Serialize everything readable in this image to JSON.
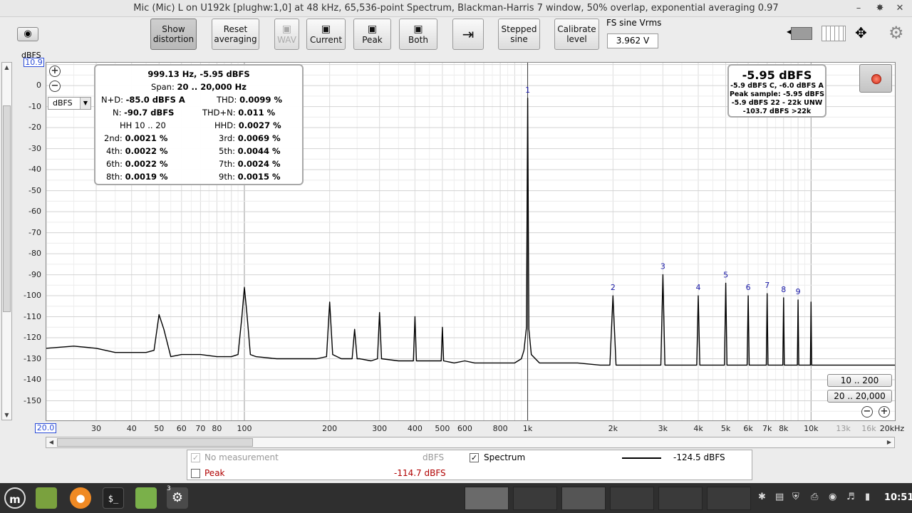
{
  "window": {
    "title": "Mic (Mic) L on U192k [plughw:1,0] at 48 kHz, 65,536-point Spectrum, Blackman-Harris 7 window, 50% overlap, exponential averaging 0.97",
    "minimize": "–",
    "restore": "✸",
    "close": "✕"
  },
  "toolbar": {
    "show_distortion_1": "Show",
    "show_distortion_2": "distortion",
    "reset_1": "Reset",
    "reset_2": "averaging",
    "wav": "WAV",
    "current": "Current",
    "peak": "Peak",
    "both": "Both",
    "stepped_1": "Stepped",
    "stepped_2": "sine",
    "calibrate_1": "Calibrate",
    "calibrate_2": "level",
    "fs_label": "FS sine Vrms",
    "fs_value": "3.962 V"
  },
  "axes": {
    "y_unit": "dBFS",
    "y_top": "10.9",
    "y_ticks": [
      "0",
      "-10",
      "-20",
      "-30",
      "-40",
      "-50",
      "-60",
      "-70",
      "-80",
      "-90",
      "-100",
      "-110",
      "-120",
      "-130",
      "-140",
      "-150"
    ],
    "x_start": "20.0",
    "x_ticks": [
      "30",
      "40",
      "50",
      "60",
      "70",
      "80",
      "100",
      "200",
      "300",
      "400",
      "500",
      "600",
      "800",
      "1k",
      "2k",
      "3k",
      "4k",
      "5k",
      "6k",
      "7k",
      "8k",
      "10k",
      "13k",
      "16k",
      "20kHz"
    ],
    "unit_select": "dBFS"
  },
  "info": {
    "line1": "999.13 Hz, -5.95 dBFS",
    "span_label": "Span:",
    "span_value": "20 .. 20,000 Hz",
    "nd_label": "N+D:",
    "nd_value": "-85.0 dBFS A",
    "thd_label": "THD:",
    "thd_value": "0.0099 %",
    "n_label": "N:",
    "n_value": "-90.7 dBFS",
    "thdn_label": "THD+N:",
    "thdn_value": "0.011 %",
    "hh_label": "HH 10 .. 20",
    "hhd_label": "HHD:",
    "hhd_value": "0.0027 %",
    "h2_label": "2nd:",
    "h2_value": "0.0021 %",
    "h3_label": "3rd:",
    "h3_value": "0.0069 %",
    "h4_label": "4th:",
    "h4_value": "0.0022 %",
    "h5_label": "5th:",
    "h5_value": "0.0044 %",
    "h6_label": "6th:",
    "h6_value": "0.0022 %",
    "h7_label": "7th:",
    "h7_value": "0.0024 %",
    "h8_label": "8th:",
    "h8_value": "0.0019 %",
    "h9_label": "9th:",
    "h9_value": "0.0015 %"
  },
  "level": {
    "main": "-5.95 dBFS",
    "l1": "-5.9 dBFS C, -6.0 dBFS A",
    "l2": "Peak sample: -5.95 dBFS",
    "l3": "-5.9 dBFS 22 - 22k UNW",
    "l4": "-103.7 dBFS >22k"
  },
  "ranges": {
    "r1": "10 .. 200",
    "r2": "20 .. 20,000"
  },
  "legend": {
    "no_measurement": "No measurement",
    "no_measurement_unit": "dBFS",
    "spectrum": "Spectrum",
    "spectrum_value": "-124.5 dBFS",
    "peak": "Peak",
    "peak_value": "-114.7 dBFS"
  },
  "taskbar": {
    "clock": "10:51",
    "badge": "3"
  },
  "chart_data": {
    "type": "line",
    "x_scale": "log",
    "xlim": [
      20,
      20000
    ],
    "ylim": [
      -160,
      10.9
    ],
    "ylabel": "dBFS",
    "grid": true,
    "harmonic_labels": [
      {
        "label": "1",
        "freq": 1000,
        "level": -6
      },
      {
        "label": "2",
        "freq": 2000,
        "level": -100
      },
      {
        "label": "3",
        "freq": 3000,
        "level": -90
      },
      {
        "label": "4",
        "freq": 4000,
        "level": -100
      },
      {
        "label": "5",
        "freq": 5000,
        "level": -94
      },
      {
        "label": "6",
        "freq": 6000,
        "level": -100
      },
      {
        "label": "7",
        "freq": 7000,
        "level": -99
      },
      {
        "label": "8",
        "freq": 8000,
        "level": -101
      },
      {
        "label": "9",
        "freq": 9000,
        "level": -102
      }
    ],
    "series": [
      {
        "name": "Spectrum",
        "color": "#000000",
        "x": [
          20,
          25,
          30,
          35,
          40,
          45,
          48,
          50,
          52,
          55,
          60,
          70,
          80,
          90,
          95,
          98,
          100,
          102,
          105,
          110,
          130,
          180,
          195,
          200,
          205,
          220,
          240,
          245,
          250,
          255,
          280,
          295,
          300,
          305,
          350,
          395,
          400,
          405,
          450,
          495,
          500,
          505,
          550,
          600,
          650,
          700,
          750,
          800,
          850,
          900,
          950,
          970,
          990,
          1000,
          1010,
          1030,
          1100,
          1300,
          1500,
          1800,
          1950,
          2000,
          2050,
          2500,
          2950,
          3000,
          3050,
          3500,
          3950,
          4000,
          4050,
          4500,
          4950,
          5000,
          5050,
          5500,
          5950,
          6000,
          6050,
          6500,
          6950,
          7000,
          7050,
          7500,
          7950,
          8000,
          8050,
          8500,
          8950,
          9000,
          9050,
          9500,
          9950,
          10000,
          10050,
          11000,
          12000,
          13000,
          14000,
          15000,
          16000,
          17000,
          18000,
          19000,
          20000
        ],
        "y": [
          -125,
          -124,
          -125,
          -127,
          -127,
          -127,
          -126,
          -109,
          -116,
          -129,
          -128,
          -128,
          -129,
          -129,
          -128,
          -110,
          -96,
          -108,
          -128,
          -129,
          -130,
          -130,
          -129,
          -103,
          -128,
          -130,
          -130,
          -116,
          -130,
          -130,
          -131,
          -130,
          -108,
          -130,
          -131,
          -131,
          -110,
          -131,
          -131,
          -131,
          -115,
          -131,
          -132,
          -131,
          -132,
          -132,
          -132,
          -132,
          -132,
          -132,
          -130,
          -126,
          -115,
          -6,
          -116,
          -128,
          -132,
          -132,
          -132,
          -133,
          -133,
          -100,
          -133,
          -133,
          -133,
          -90,
          -133,
          -133,
          -133,
          -100,
          -133,
          -133,
          -133,
          -94,
          -133,
          -133,
          -133,
          -100,
          -133,
          -133,
          -133,
          -99,
          -133,
          -133,
          -133,
          -101,
          -133,
          -133,
          -133,
          -102,
          -133,
          -133,
          -133,
          -103,
          -133,
          -133,
          -133,
          -133,
          -133,
          -133,
          -133,
          -133,
          -133,
          -133,
          -133
        ]
      }
    ]
  }
}
